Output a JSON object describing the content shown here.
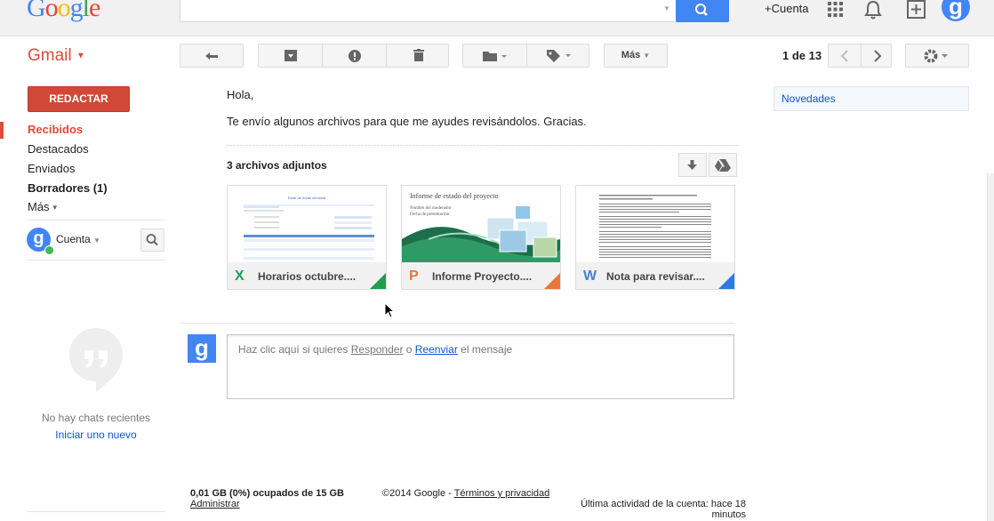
{
  "header": {
    "logo_letters": [
      {
        "ch": "G",
        "color": "#4285f4"
      },
      {
        "ch": "o",
        "color": "#ea4335"
      },
      {
        "ch": "o",
        "color": "#fbbc05"
      },
      {
        "ch": "g",
        "color": "#4285f4"
      },
      {
        "ch": "l",
        "color": "#34a853"
      },
      {
        "ch": "e",
        "color": "#ea4335"
      }
    ],
    "search_value": "",
    "account_link": "+Cuenta",
    "avatar_letter": "g"
  },
  "toolbar": {
    "app_label": "Gmail",
    "more_label": "Más",
    "pager": "1 de 13"
  },
  "sidebar": {
    "compose_label": "REDACTAR",
    "items": [
      {
        "label": "Recibidos",
        "active": true
      },
      {
        "label": "Destacados"
      },
      {
        "label": "Enviados"
      },
      {
        "label": "Borradores (1)",
        "bold": true
      },
      {
        "label": "Más"
      }
    ],
    "chat_user": "Cuenta",
    "no_chats": "No hay chats recientes",
    "start_new": "Iniciar uno nuevo"
  },
  "message": {
    "greeting": "Hola,",
    "body": "Te envío algunos archivos para que me ayudes revisándolos. Gracias.",
    "attachments_title": "3 archivos adjuntos",
    "attachments": [
      {
        "name": "Horarios octubre....",
        "type_letter": "X",
        "type_color": "#1f9d55",
        "corner_color": "#1e9e4a",
        "thumb_title": "Parte de horas semanal"
      },
      {
        "name": "Informe Proyecto....",
        "type_letter": "P",
        "type_color": "#e8773a",
        "corner_color": "#e8773a",
        "thumb_title": "Informe de estado del proyecto",
        "thumb_sub1": "Nombre del moderador",
        "thumb_sub2": "Fecha de presentación"
      },
      {
        "name": "Nota para revisar....",
        "type_letter": "W",
        "type_color": "#4a7fd4",
        "corner_color": "#2d7be0"
      }
    ]
  },
  "reply": {
    "prefix": "Haz clic aquí si quieres ",
    "reply_link": "Responder",
    "middle": " o ",
    "forward_link": "Reenviar",
    "suffix": " el mensaje"
  },
  "right_panel": {
    "novedades": "Novedades"
  },
  "footer": {
    "storage": "0,01 GB (0%) ocupados de 15 GB",
    "manage": "Administrar",
    "copyright": "©2014 Google - ",
    "terms": "Términos y privacidad",
    "activity_line1": "Última actividad de la cuenta: hace 18",
    "activity_line2": "minutos"
  }
}
